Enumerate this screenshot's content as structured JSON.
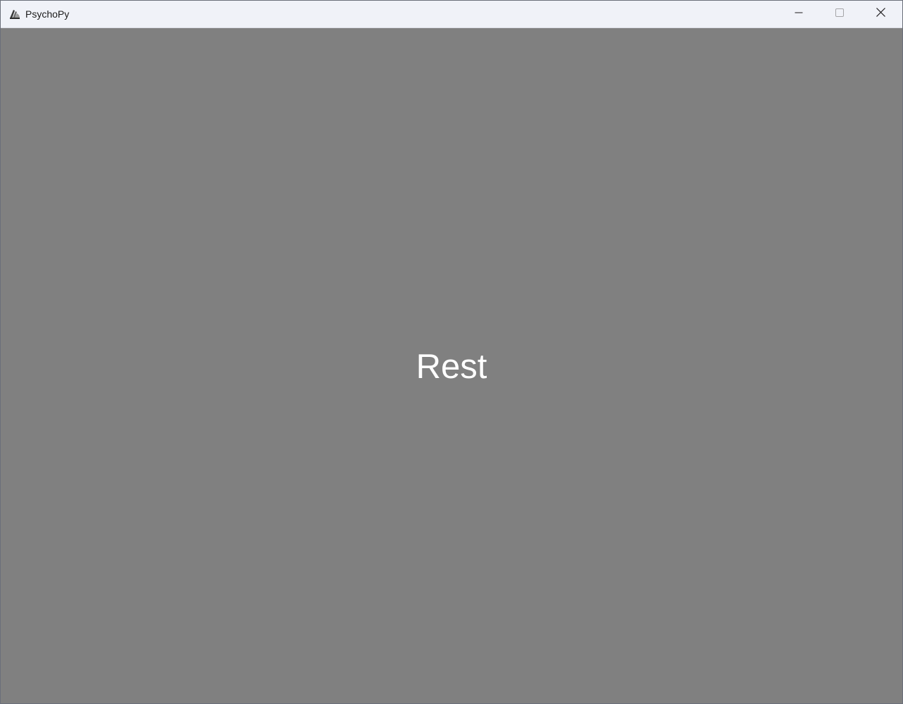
{
  "window": {
    "title": "PsychoPy",
    "icon": "psychopy-logo-icon",
    "controls": {
      "minimize_icon": "minimize-icon",
      "maximize_icon": "maximize-icon",
      "close_icon": "close-icon"
    }
  },
  "content": {
    "background_color": "#808080",
    "text_color": "#ffffff",
    "stimulus_text": "Rest"
  }
}
